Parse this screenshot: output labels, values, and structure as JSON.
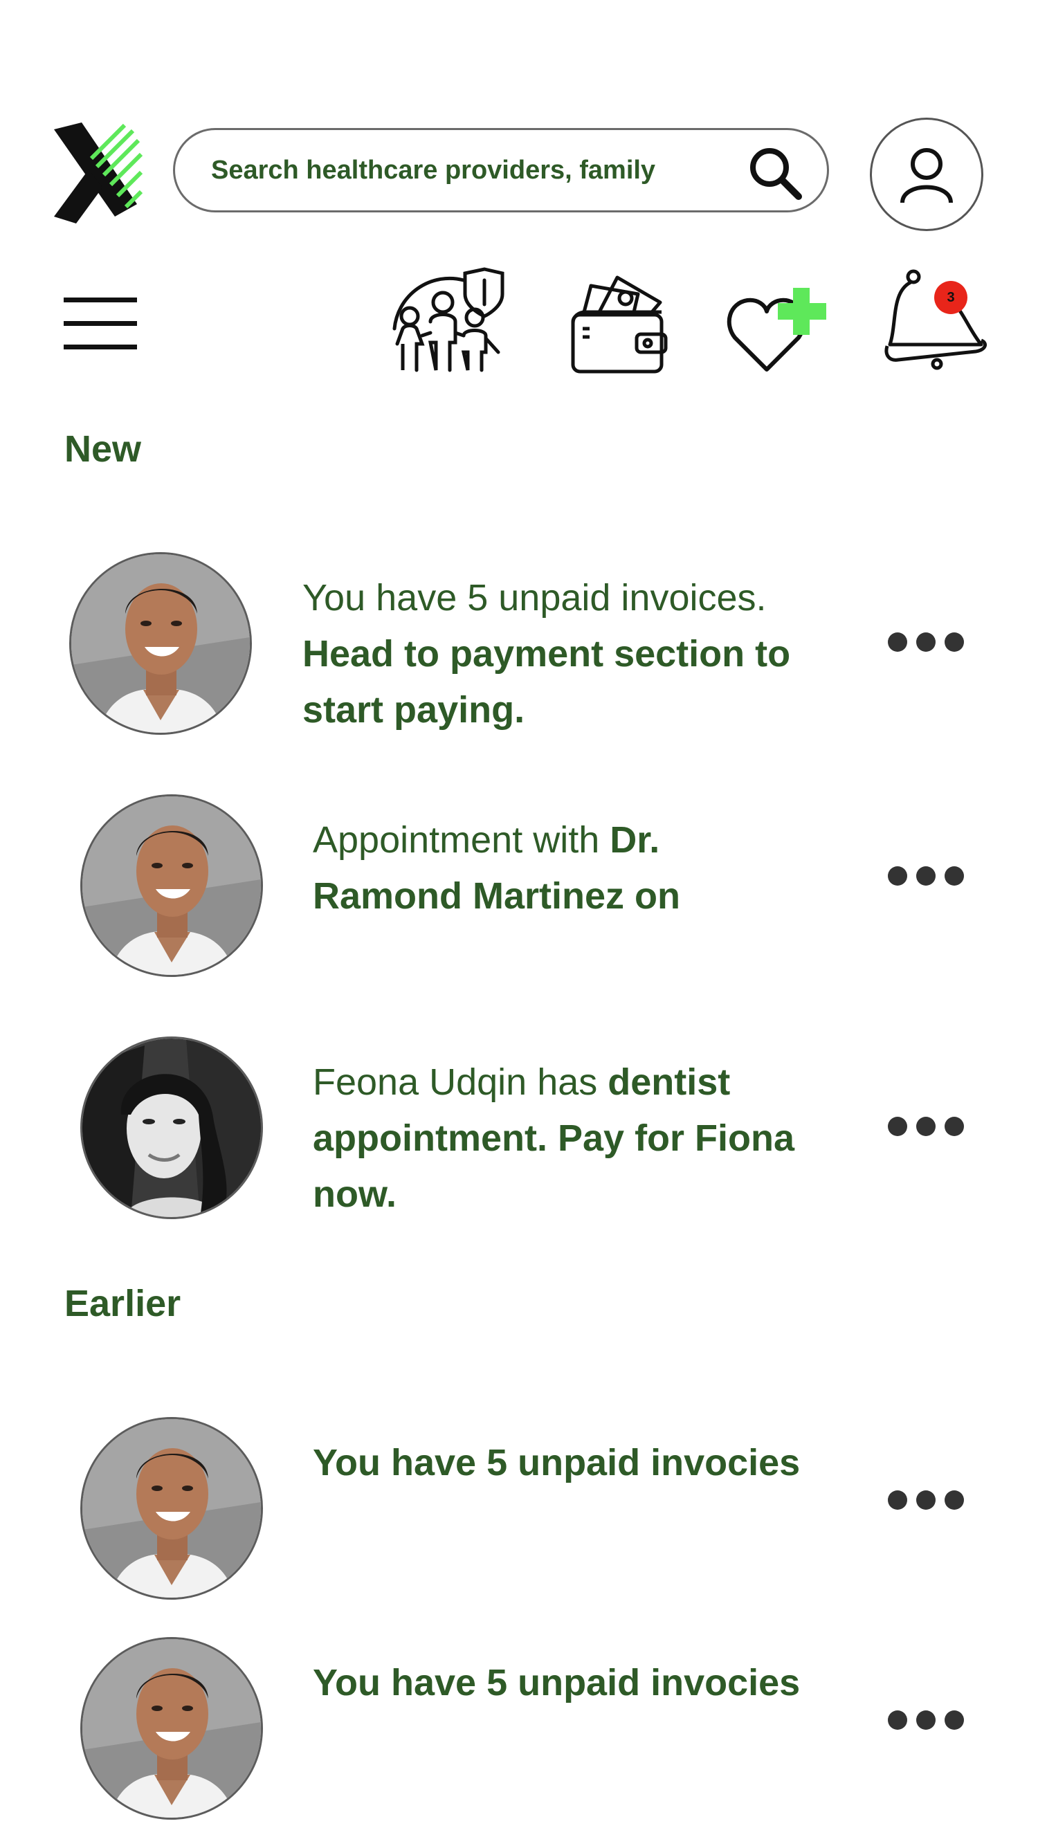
{
  "header": {
    "search_placeholder": "Search healthcare providers, family"
  },
  "nav": {
    "notification_count": "3"
  },
  "sections": {
    "new_title": "New",
    "earlier_title": "Earlier"
  },
  "notifications": {
    "n1": {
      "plain": "You have 5 unpaid invoices.",
      "bold": "Head to payment section to start paying."
    },
    "n2": {
      "plain": "Appointment with ",
      "bold": "Dr. Ramond Martinez on"
    },
    "n3": {
      "plain": "Feona Udqin has ",
      "bold": "dentist appointment. Pay for Fiona now."
    },
    "n4": {
      "bold": "You have 5 unpaid invocies"
    },
    "n5": {
      "bold": "You have 5 unpaid invocies"
    }
  },
  "colors": {
    "text_green": "#2e5a27",
    "accent_green": "#5ee85a",
    "badge_red": "#e8251a"
  }
}
